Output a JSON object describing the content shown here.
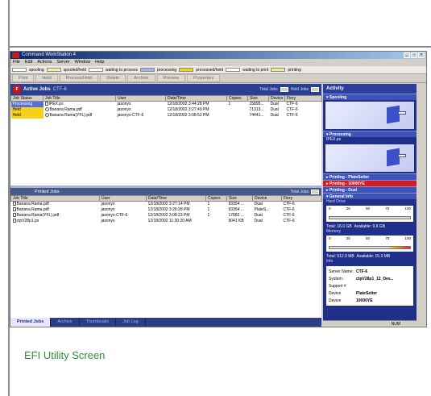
{
  "window": {
    "title": "Command WorkStation 4",
    "menu": [
      "File",
      "Edit",
      "Actions",
      "Server",
      "Window",
      "Help"
    ],
    "controls": {
      "min": "_",
      "restore": "▫",
      "close": "×"
    },
    "legend": [
      {
        "label": "spooling",
        "color": "#ffffff"
      },
      {
        "label": "spooled/held",
        "color": "#f7f0a0"
      },
      {
        "label": "waiting to process",
        "color": "#ffffff"
      },
      {
        "label": "processing",
        "color": "#a8b3f0"
      },
      {
        "label": "processed/held",
        "color": "#f5d21a"
      },
      {
        "label": "waiting to print",
        "color": "#ffffff"
      },
      {
        "label": "printing",
        "color": "#f3ef8a"
      }
    ],
    "toolbar": [
      "Print",
      "Hold",
      "Process/Hold",
      "Delete",
      "Archive",
      "Preview",
      "Properties"
    ]
  },
  "active_jobs": {
    "title": "Active Jobs",
    "server": "CTF-6",
    "total_label": "Total Jobs",
    "held_label": "Held Jobs",
    "columns": [
      "Job Status",
      "Job Title",
      "User",
      "Date/Time",
      "Copies",
      "Size",
      "Device",
      "Fiery"
    ],
    "rows": [
      {
        "status": "Processing",
        "title": "IPEX.ps",
        "user": "jasonyx",
        "date": "12/18/2002 3:44:28 PM",
        "copies": "1",
        "size": "15895...",
        "device": "Dual",
        "fiery": "CTF-6"
      },
      {
        "status": "Held",
        "title": "Banana Rama.pdf",
        "user": "jasonyx",
        "date": "12/18/2002 3:27:49 PM",
        "copies": "",
        "size": "71313...",
        "device": "Dual",
        "fiery": "CTF-6"
      },
      {
        "status": "Held",
        "title": "Banana Rama(YFL).pdf",
        "user": "jasonyx-CTF-6",
        "date": "12/18/2002 3:08:52 PM",
        "copies": "",
        "size": "74441...",
        "device": "Dual",
        "fiery": "CTF-6"
      }
    ]
  },
  "printed_jobs": {
    "title": "Printed Jobs",
    "total_label": "Total Jobs",
    "columns": [
      "Job Title",
      "User",
      "Date/Time",
      "Copies",
      "Size",
      "Device",
      "Fiery"
    ],
    "rows": [
      {
        "title": "Banana Rama.pdf",
        "user": "jasonyx",
        "date": "12/18/2002 3:27:14 PM",
        "copies": "1",
        "size": "93354 ...",
        "device": "Dual",
        "fiery": "CTF-6"
      },
      {
        "title": "Banana Rama.pdf",
        "user": "jasonyx",
        "date": "12/18/2002 3:26:28 PM",
        "copies": "1",
        "size": "93354 ...",
        "device": "PlateS...",
        "fiery": "CTF-6"
      },
      {
        "title": "Banana Rama(YFL).pdf",
        "user": "jasonyx-CTF-6",
        "date": "12/18/2002 3:08:23 PM",
        "copies": "1",
        "size": "17882 ...",
        "device": "Dual",
        "fiery": "CTF-6"
      },
      {
        "title": "ctpV28p1.ps",
        "user": "jasonyx",
        "date": "12/18/2002 11:30:20 AM",
        "copies": "",
        "size": "9041 KB",
        "device": "Dual",
        "fiery": "CTF-6"
      }
    ]
  },
  "bottom_tabs": [
    "Printed Jobs",
    "Archive",
    "Thumbnails",
    "Job Log"
  ],
  "activity": {
    "title": "Activity",
    "spooling": "Spooling",
    "processing": "Processing",
    "processing_file": "IPEX.ps",
    "printing": [
      {
        "label": "Printing - PlateSetter",
        "alert": false
      },
      {
        "label": "Printing - 10000YE",
        "alert": true
      },
      {
        "label": "Printing - Dual",
        "alert": false
      }
    ],
    "general_info": "General Info",
    "hard_drive_label": "Hard Drive",
    "memory_label": "Memory",
    "scale": [
      "0",
      "25",
      "50",
      "75",
      "100"
    ],
    "hd_fill_fraction": 0.0,
    "hd_total": "Total: 16.0 GB",
    "hd_available": "Available: 9.6 GB",
    "mem_fill_fraction": 0.25,
    "mem_total": "Total: 512.0 MB",
    "mem_available": "Available: 15.3 MB",
    "info_label": "Info",
    "info": [
      {
        "k": "Server Name:",
        "v": "CTF-6"
      },
      {
        "k": "System:",
        "v": "ctpV28p1_12_Dev..."
      },
      {
        "k": "Support #",
        "v": ""
      },
      {
        "k": "Device",
        "v": "PlateSetter"
      },
      {
        "k": "Device",
        "v": "10000YE"
      }
    ],
    "status_right": "NUM"
  },
  "caption": "EFI Utility Screen"
}
